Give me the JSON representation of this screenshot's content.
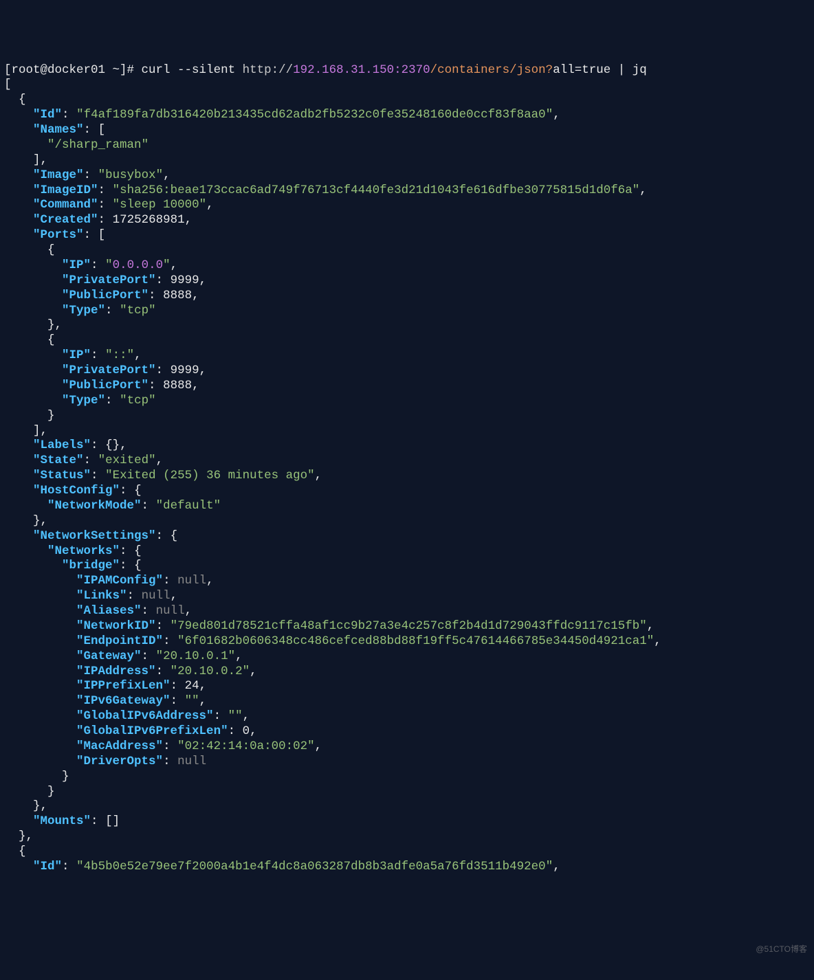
{
  "prompt": {
    "user": "[root@docker01 ~]#",
    "command": "curl --silent",
    "scheme": "http://",
    "host": "192.168.31.150:2370",
    "path": "/containers/json?",
    "query": "all=true",
    "pipe": " | jq"
  },
  "container": {
    "Id": "f4af189fa7db316420b213435cd62adb2fb5232c0fe35248160de0ccf83f8aa0",
    "Names": [
      "/sharp_raman"
    ],
    "Image": "busybox",
    "ImageID": "sha256:beae173ccac6ad749f76713cf4440fe3d21d1043fe616dfbe30775815d1d0f6a",
    "Command": "sleep 10000",
    "Created": 1725268981,
    "Ports": [
      {
        "IP": "0.0.0.0",
        "PrivatePort": 9999,
        "PublicPort": 8888,
        "Type": "tcp"
      },
      {
        "IP": "::",
        "PrivatePort": 9999,
        "PublicPort": 8888,
        "Type": "tcp"
      }
    ],
    "Labels": "{},",
    "State": "exited",
    "Status": "Exited (255) 36 minutes ago",
    "HostConfig": {
      "NetworkMode": "default"
    },
    "NetworkSettings": {
      "Networks": {
        "bridge": {
          "IPAMConfig": "null",
          "Links": "null",
          "Aliases": "null",
          "NetworkID": "79ed801d78521cffa48af1cc9b27a3e4c257c8f2b4d1d729043ffdc9117c15fb",
          "EndpointID": "6f01682b0606348cc486cefced88bd88f19ff5c47614466785e34450d4921ca1",
          "Gateway": "20.10.0.1",
          "IPAddress": "20.10.0.2",
          "IPPrefixLen": 24,
          "IPv6Gateway": "",
          "GlobalIPv6Address": "",
          "GlobalIPv6PrefixLen": 0,
          "MacAddress": "02:42:14:0a:00:02",
          "DriverOpts": "null"
        }
      }
    },
    "Mounts": "[]"
  },
  "next": {
    "Id": "4b5b0e52e79ee7f2000a4b1e4f4dc8a063287db8b3adfe0a5a76fd3511b492e0"
  },
  "watermark": "@51CTO博客"
}
